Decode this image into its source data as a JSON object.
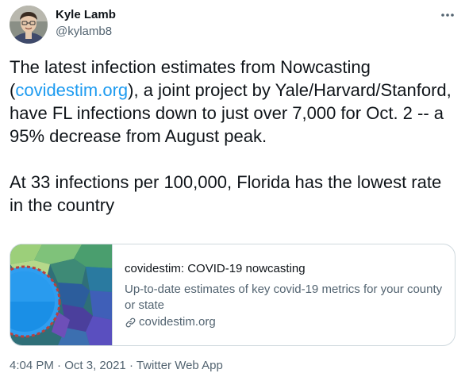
{
  "author": {
    "name": "Kyle Lamb",
    "handle": "@kylamb8"
  },
  "tweet": {
    "text_line1_before": "The latest infection estimates from Nowcasting (",
    "link_text": "covidestim.org",
    "text_line1_after": "), a joint project by Yale/Harvard/Stanford, have FL infections down to just over 7,000 for Oct. 2 -- a 95% decrease from August peak.",
    "paragraph2": "At 33 infections per 100,000, Florida has the lowest rate in the country"
  },
  "card": {
    "title": "covidestim: COVID-19 nowcasting",
    "description": "Up-to-date estimates of key covid-19 metrics for your county or state",
    "domain": "covidestim.org"
  },
  "meta": {
    "time": "4:04 PM",
    "separator": "·",
    "date": "Oct 3, 2021",
    "source": "Twitter Web App"
  },
  "colors": {
    "link": "#1d9bf0",
    "secondary_text": "#536471",
    "border": "#cfd9de"
  },
  "icons": {
    "more": "more-horizontal-icon",
    "link": "link-icon"
  }
}
